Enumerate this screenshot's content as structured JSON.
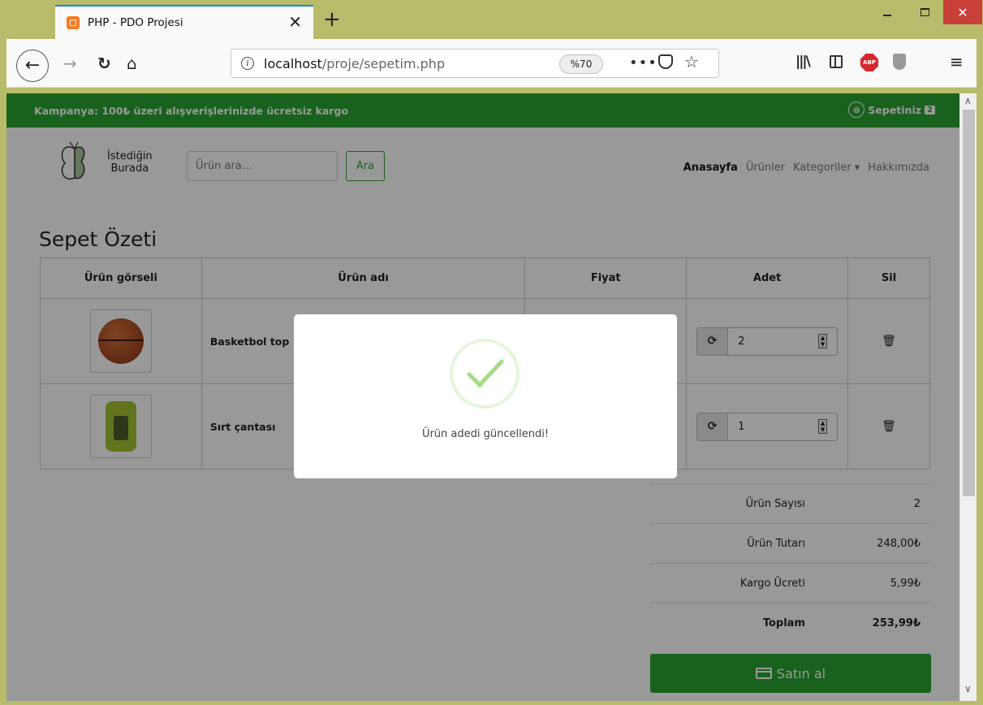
{
  "browser": {
    "tab_title": "PHP - PDO Projesi",
    "url_host": "localhost",
    "url_path": "/proje/sepetim.php",
    "zoom": "%70",
    "close_glyph": "✕",
    "new_tab_glyph": "+",
    "page_actions_glyph": "•••",
    "menu_glyph": "≡",
    "abp_label": "ABP"
  },
  "site": {
    "campaign": "Kampanya: 100₺ üzeri alışverişlerinizde ücretsiz kargo",
    "cart_label": "Sepetiniz",
    "cart_count": "2",
    "logo_line1": "İstediğin",
    "logo_line2": "Burada",
    "search_placeholder": "Ürün ara...",
    "search_button": "Ara",
    "nav": [
      "Anasayfa",
      "Ürünler",
      "Kategoriler ▾",
      "Hakkımızda"
    ]
  },
  "cart": {
    "title": "Sepet Özeti",
    "headers": [
      "Ürün görseli",
      "Ürün adı",
      "Fiyat",
      "Adet",
      "Sil"
    ],
    "rows": [
      {
        "name": "Basketbol top",
        "qty": "2"
      },
      {
        "name": "Sırt çantası",
        "qty": "1"
      }
    ],
    "summary": [
      {
        "label": "Ürün Sayısı",
        "value": "2"
      },
      {
        "label": "Ürün Tutarı",
        "value": "248,00₺"
      },
      {
        "label": "Kargo Ücreti",
        "value": "5,99₺"
      },
      {
        "label": "Toplam",
        "value": "253,99₺"
      }
    ],
    "buy_button": "Satın al"
  },
  "modal": {
    "message": "Ürün adedi güncellendi!"
  },
  "colors": {
    "brand": "#2aa332",
    "window": "#b8bc6a",
    "close": "#c7403a"
  }
}
